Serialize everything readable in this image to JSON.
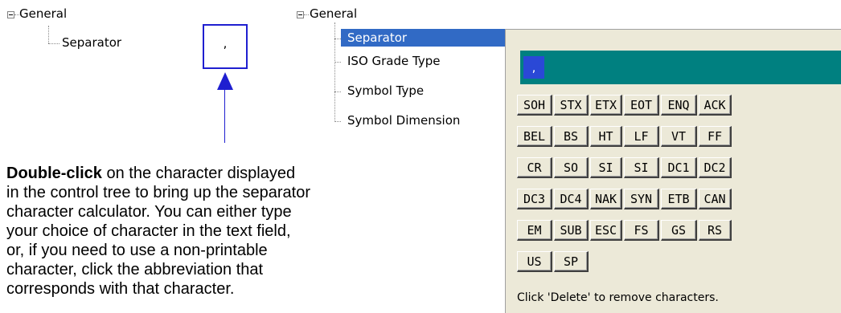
{
  "left_tree": {
    "root_label": "General",
    "child_label": "Separator",
    "char_value": ","
  },
  "description": {
    "bold_lead": "Double-click",
    "text": " on the character displayed in the control tree to bring up the separator character calculator. You can either type your choice of character in the text field, or, if you need to use a non-printable character, click the abbreviation that corresponds with that character."
  },
  "right_tree": {
    "root_label": "General",
    "items": [
      "Separator",
      "ISO Grade Type",
      "Symbol Type",
      "Symbol Dimension"
    ],
    "selected_index": 0
  },
  "calculator": {
    "field_value": ",",
    "keys": [
      [
        "SOH",
        "STX",
        "ETX",
        "EOT",
        "ENQ",
        "ACK"
      ],
      [
        "BEL",
        "BS",
        "HT",
        "LF",
        "VT",
        "FF"
      ],
      [
        "CR",
        "SO",
        "SI",
        "SI",
        "DC1",
        "DC2"
      ],
      [
        "DC3",
        "DC4",
        "NAK",
        "SYN",
        "ETB",
        "CAN"
      ],
      [
        "EM",
        "SUB",
        "ESC",
        "FS",
        "GS",
        "RS"
      ],
      [
        "US",
        "SP"
      ]
    ],
    "hint": "Click 'Delete' to remove characters."
  }
}
